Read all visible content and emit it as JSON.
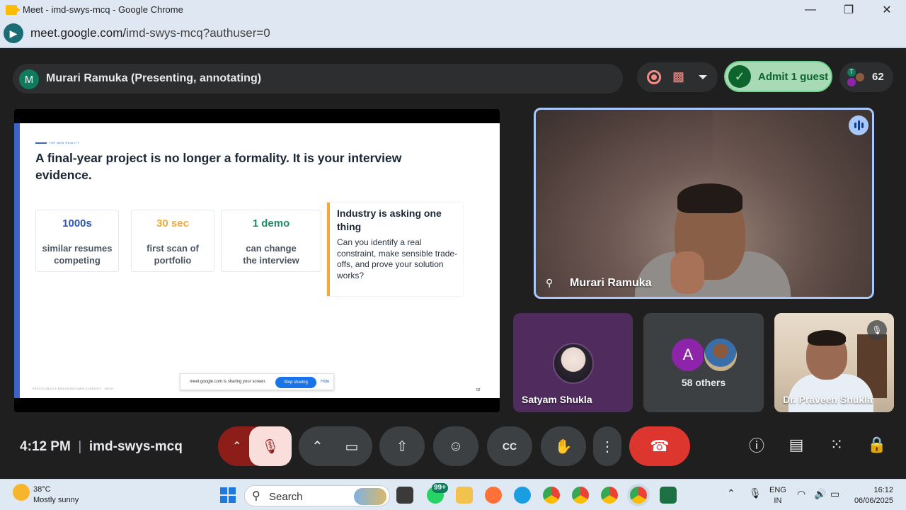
{
  "window": {
    "title": "Meet - imd-swys-mcq - Google Chrome",
    "controls": {
      "minimize": "—",
      "maximize": "❐",
      "close": "✕"
    }
  },
  "browser": {
    "url_domain": "meet.google.com/",
    "url_path": "imd-swys-mcq?authuser=0"
  },
  "meet": {
    "presenter_initial": "M",
    "presenter_label": "Murari Ramuka (Presenting, annotating)",
    "admit_label": "Admit 1 guest",
    "participant_count": "62",
    "people_avatar_initial": "T",
    "accent_color": "#a8c7fa",
    "end_call_color": "#dc362e"
  },
  "slide": {
    "kicker": "THE NEW REALITY",
    "headline": "A final-year project is no longer a formality. It is your interview evidence.",
    "cards": [
      {
        "value": "1000s",
        "desc": "similar resumes competing",
        "color": "#2f57b3"
      },
      {
        "value": "30 sec",
        "desc": "first scan of portfolio",
        "color": "#f3a93a"
      },
      {
        "value": "1 demo",
        "desc": "can change the interview",
        "color": "#1e8a6a"
      }
    ],
    "industry_title": "Industry is asking one thing",
    "industry_body": "Can you identify a real constraint, make sensible trade-offs, and prove your solution works?",
    "footer": "PROTOCONOCLE BRIDGEINGCOMPS ECRESOFT · IMCHY",
    "page": "02",
    "share_text": "meet.google.com is sharing your screen.",
    "stop_sharing": "Stop sharing",
    "hide": "Hide"
  },
  "tiles": {
    "main_name": "Murari Ramuka",
    "tile1_name": "Satyam Shukla",
    "tile2_initial": "A",
    "tile2_label": "58 others",
    "tile3_name": "Dr. Praveen Shukla"
  },
  "controls": {
    "time": "4:12 PM",
    "separator": "|",
    "meeting_code": "imd-swys-mcq"
  },
  "taskbar": {
    "temperature": "38°C",
    "weather": "Mostly sunny",
    "search": "Search",
    "whatsapp_badge": "99+",
    "lang_top": "ENG",
    "lang_bottom": "IN",
    "clock_time": "16:12",
    "clock_date": "06/06/2025"
  }
}
